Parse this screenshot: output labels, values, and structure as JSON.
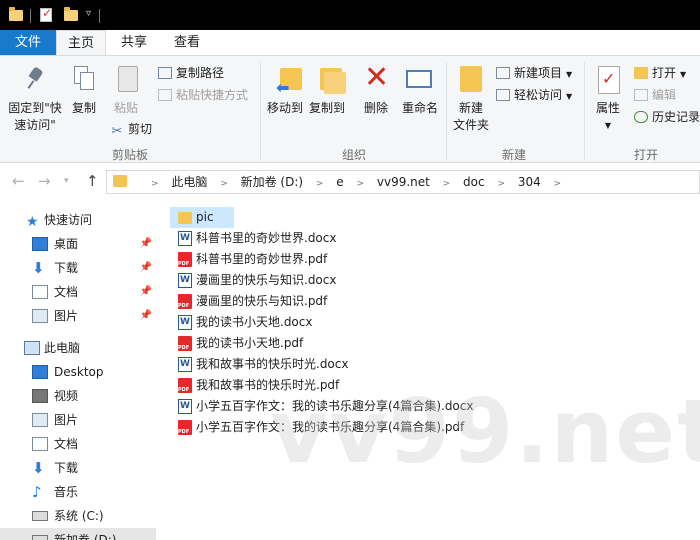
{
  "tabs": {
    "file": "文件",
    "home": "主页",
    "share": "共享",
    "view": "查看"
  },
  "ribbon": {
    "clipboard": {
      "pin_label_1": "固定到\"快",
      "pin_label_2": "速访问\"",
      "copy": "复制",
      "paste": "粘贴",
      "copy_path": "复制路径",
      "paste_shortcut": "粘贴快捷方式",
      "cut": "剪切",
      "group": "剪贴板"
    },
    "organize": {
      "move_to": "移动到",
      "copy_to": "复制到",
      "delete": "删除",
      "rename": "重命名",
      "group": "组织"
    },
    "new": {
      "new_folder_1": "新建",
      "new_folder_2": "文件夹",
      "new_item": "新建项目",
      "easy_access": "轻松访问",
      "group": "新建"
    },
    "open": {
      "properties": "属性",
      "open": "打开",
      "edit": "编辑",
      "history": "历史记录",
      "group": "打开"
    }
  },
  "address": {
    "crumbs": [
      "此电脑",
      "新加卷 (D:)",
      "e",
      "vv99.net",
      "doc",
      "304"
    ]
  },
  "sidebar": {
    "quick_access": "快速访问",
    "quick_items": [
      {
        "label": "桌面",
        "icon": "desktop-icon"
      },
      {
        "label": "下载",
        "icon": "download-icon"
      },
      {
        "label": "文档",
        "icon": "documents-icon"
      },
      {
        "label": "图片",
        "icon": "pictures-icon"
      }
    ],
    "this_pc": "此电脑",
    "pc_items": [
      {
        "label": "Desktop",
        "icon": "desktop-icon"
      },
      {
        "label": "视频",
        "icon": "videos-icon"
      },
      {
        "label": "图片",
        "icon": "pictures-icon"
      },
      {
        "label": "文档",
        "icon": "documents-icon"
      },
      {
        "label": "下载",
        "icon": "download-icon"
      },
      {
        "label": "音乐",
        "icon": "music-icon"
      },
      {
        "label": "系统 (C:)",
        "icon": "drive-icon"
      },
      {
        "label": "新加卷 (D:)",
        "icon": "drive-icon"
      }
    ]
  },
  "files": [
    {
      "name": "pic",
      "type": "folder"
    },
    {
      "name": "科普书里的奇妙世界.docx",
      "type": "word"
    },
    {
      "name": "科普书里的奇妙世界.pdf",
      "type": "pdf"
    },
    {
      "name": "漫画里的快乐与知识.docx",
      "type": "word"
    },
    {
      "name": "漫画里的快乐与知识.pdf",
      "type": "pdf"
    },
    {
      "name": "我的读书小天地.docx",
      "type": "word"
    },
    {
      "name": "我的读书小天地.pdf",
      "type": "pdf"
    },
    {
      "name": "我和故事书的快乐时光.docx",
      "type": "word"
    },
    {
      "name": "我和故事书的快乐时光.pdf",
      "type": "pdf"
    },
    {
      "name": "小学五百字作文：我的读书乐趣分享(4篇合集).docx",
      "type": "word"
    },
    {
      "name": "小学五百字作文：我的读书乐趣分享(4篇合集).pdf",
      "type": "pdf"
    }
  ],
  "watermark": "vv99.net",
  "colors": {
    "accent": "#1979ca",
    "selection": "#cce8ff",
    "folder": "#f4c553",
    "pdf": "#e32a2a",
    "delete": "#d32a1f"
  }
}
